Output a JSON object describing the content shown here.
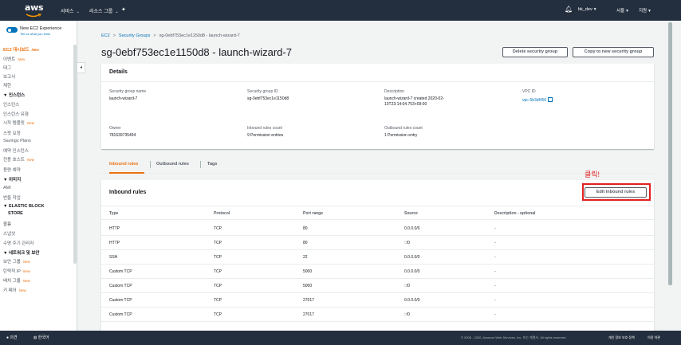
{
  "topbar": {
    "logo_text": "aws",
    "services": "서비스",
    "resource_groups": "리소스 그룹",
    "account": "bk_dev",
    "region": "서울",
    "support": "지원"
  },
  "sidebar": {
    "experience_title": "New EC2 Experience",
    "experience_sub": "Tell us what you think",
    "new_badge": "New",
    "items": [
      {
        "label": "EC2 대시보드",
        "new": true,
        "active": true
      },
      {
        "label": "이벤트",
        "new": true
      },
      {
        "label": "태그"
      },
      {
        "label": "보고서"
      },
      {
        "label": "제한"
      },
      {
        "label": "▼ 인스턴스",
        "section": true
      },
      {
        "label": "인스턴스"
      },
      {
        "label": "인스턴스 유형"
      },
      {
        "label": "시작 템플릿",
        "new": true
      },
      {
        "label": "스팟 요청"
      },
      {
        "label": "Savings Plans"
      },
      {
        "label": "예약 인스턴스"
      },
      {
        "label": "전용 호스트",
        "new": true
      },
      {
        "label": "용량 예약"
      },
      {
        "label": "▼ 이미지",
        "section": true
      },
      {
        "label": "AMI"
      },
      {
        "label": "번들 작업"
      },
      {
        "label": "▼ ELASTIC BLOCK",
        "section": true
      },
      {
        "label": "STORE",
        "section": true
      },
      {
        "label": "볼륨"
      },
      {
        "label": "스냅샷"
      },
      {
        "label": "수명 주기 관리자"
      },
      {
        "label": "▼ 네트워크 및 보안",
        "section": true
      },
      {
        "label": "보안 그룹",
        "new": true
      },
      {
        "label": "탄력적 IP",
        "new": true
      },
      {
        "label": "배치 그룹",
        "new": true
      },
      {
        "label": "키 페어",
        "new": true
      }
    ]
  },
  "breadcrumb": {
    "ec2": "EC2",
    "security_groups": "Security Groups",
    "current": "sg-0ebf753ec1e1150d8 - launch-wizard-7"
  },
  "page": {
    "title": "sg-0ebf753ec1e1150d8 - launch-wizard-7",
    "delete_button": "Delete security group",
    "copy_button": "Copy to new security group"
  },
  "details": {
    "header": "Details",
    "sg_name_label": "Security group name",
    "sg_name_value": "launch-wizard-7",
    "sg_id_label": "Security group ID",
    "sg_id_value": "sg-0ebf753ec1e1150d8",
    "description_label": "Description",
    "description_value": "launch-wizard-7 created 2020-02-10T23:14:04.753+09:00",
    "vpc_label": "VPC ID",
    "vpc_value": "vpc-5b3df450",
    "owner_label": "Owner",
    "owner_value": "781639735494",
    "inbound_count_label": "Inbound rules count",
    "inbound_count_value": "9 Permission entries",
    "outbound_count_label": "Outbound rules count",
    "outbound_count_value": "1 Permission entry"
  },
  "tabs": {
    "inbound": "Inbound rules",
    "outbound": "Outbound rules",
    "tags": "Tags"
  },
  "annotation": "클릭!",
  "inbound": {
    "header": "Inbound rules",
    "edit_button": "Edit inbound rules",
    "columns": [
      "Type",
      "Protocol",
      "Port range",
      "Source",
      "Description - optional"
    ],
    "rows": [
      [
        "HTTP",
        "TCP",
        "80",
        "0.0.0.0/0",
        "-"
      ],
      [
        "HTTP",
        "TCP",
        "80",
        "::/0",
        "-"
      ],
      [
        "SSH",
        "TCP",
        "22",
        "0.0.0.0/0",
        "-"
      ],
      [
        "Custom TCP",
        "TCP",
        "5000",
        "0.0.0.0/0",
        "-"
      ],
      [
        "Custom TCP",
        "TCP",
        "5000",
        "::/0",
        "-"
      ],
      [
        "Custom TCP",
        "TCP",
        "27017",
        "0.0.0.0/0",
        "-"
      ],
      [
        "Custom TCP",
        "TCP",
        "27017",
        "::/0",
        "-"
      ]
    ]
  },
  "footer": {
    "feedback": "의견",
    "language": "한국어",
    "copyright": "© 2008 - 2020, Amazon Web Services, Inc. 또는 계열사. All rights reserved.",
    "privacy": "개인 정보 보호 정책",
    "terms": "이용 약관"
  }
}
